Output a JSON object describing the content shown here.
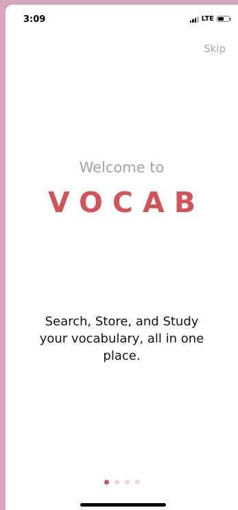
{
  "status_bar": {
    "time": "3:09",
    "network": "LTE",
    "battery_level": 0.55
  },
  "header": {
    "skip_label": "Skip"
  },
  "onboarding": {
    "welcome_text": "Welcome to",
    "app_name": "VOCAB",
    "tagline": "Search, Store, and Study your vocabulary, all in one place.",
    "pages_total": 4,
    "current_page": 1
  },
  "colors": {
    "brand": "#d1545a",
    "muted_text": "#a3a3a3",
    "dot_inactive": "#f2d6dc",
    "background_frame": "#d7a6bd"
  },
  "icons": {
    "signal": "signal-icon",
    "battery": "battery-icon",
    "home": "home-indicator"
  }
}
